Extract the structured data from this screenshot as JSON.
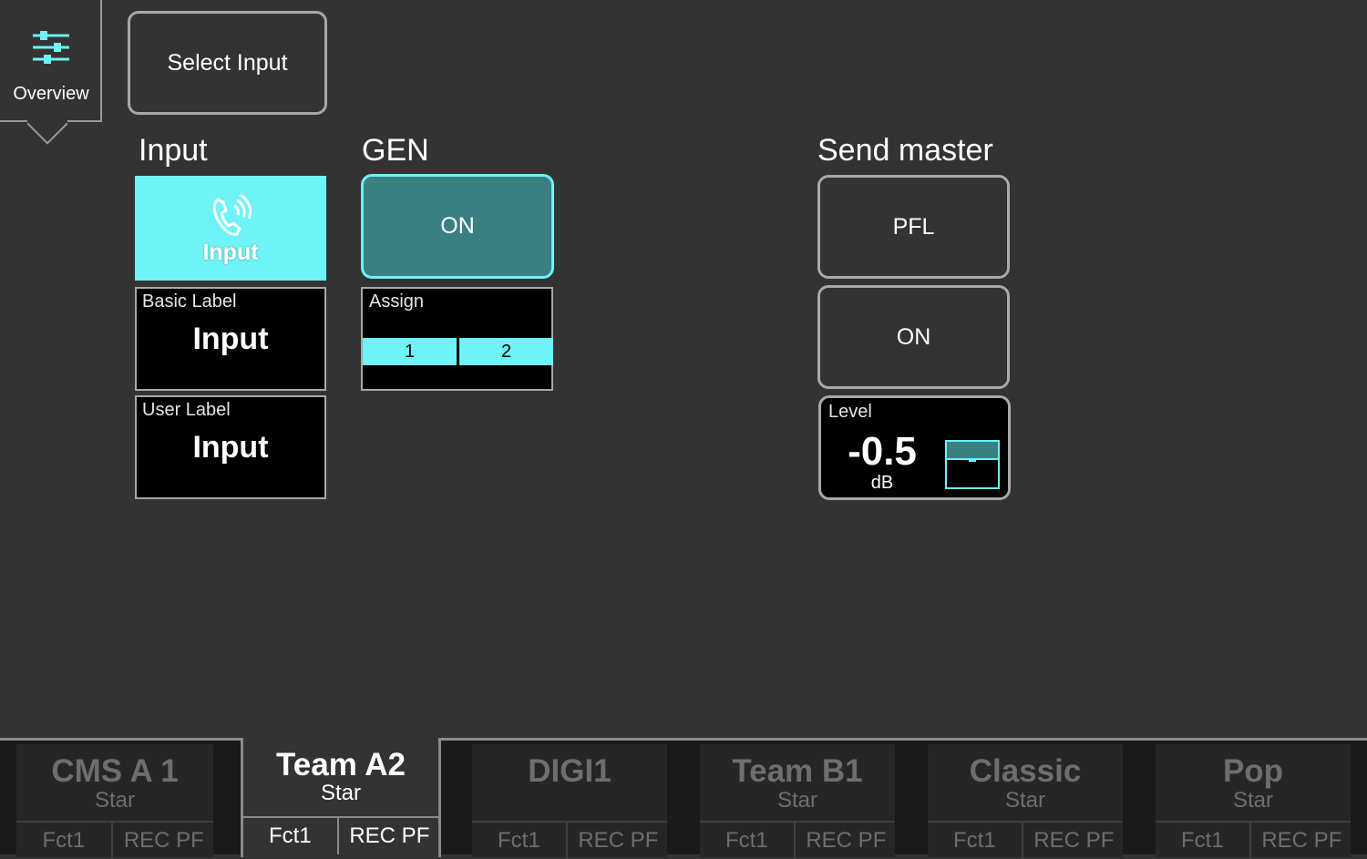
{
  "overview": {
    "label": "Overview",
    "icon": "sliders-icon"
  },
  "select_input": {
    "label": "Select Input"
  },
  "input_section": {
    "title": "Input",
    "tile_label": "Input",
    "tile_icon": "phone-ringing-icon",
    "basic_label": {
      "caption": "Basic Label",
      "value": "Input"
    },
    "user_label": {
      "caption": "User Label",
      "value": "Input"
    }
  },
  "gen_section": {
    "title": "GEN",
    "on_button": "ON",
    "assign": {
      "caption": "Assign",
      "slots": [
        "1",
        "2"
      ]
    }
  },
  "send_master": {
    "title": "Send master",
    "pfl_button": "PFL",
    "on_button": "ON",
    "level": {
      "caption": "Level",
      "value": "-0.5",
      "unit": "dB"
    }
  },
  "tabs": [
    {
      "name": "CMS A 1",
      "sub": "Star",
      "f1": "Fct1",
      "f2": "REC PF",
      "active": false
    },
    {
      "name": "Team A2",
      "sub": "Star",
      "f1": "Fct1",
      "f2": "REC PF",
      "active": true
    },
    {
      "name": "DIGI1",
      "sub": "",
      "f1": "Fct1",
      "f2": "REC PF",
      "active": false
    },
    {
      "name": "Team B1",
      "sub": "Star",
      "f1": "Fct1",
      "f2": "REC PF",
      "active": false
    },
    {
      "name": "Classic",
      "sub": "Star",
      "f1": "Fct1",
      "f2": "REC PF",
      "active": false
    },
    {
      "name": "Pop",
      "sub": "Star",
      "f1": "Fct1",
      "f2": "REC PF",
      "active": false
    }
  ],
  "colors": {
    "accent": "#6ef3f7",
    "gen_on": "#3a7f82",
    "background": "#333333"
  }
}
